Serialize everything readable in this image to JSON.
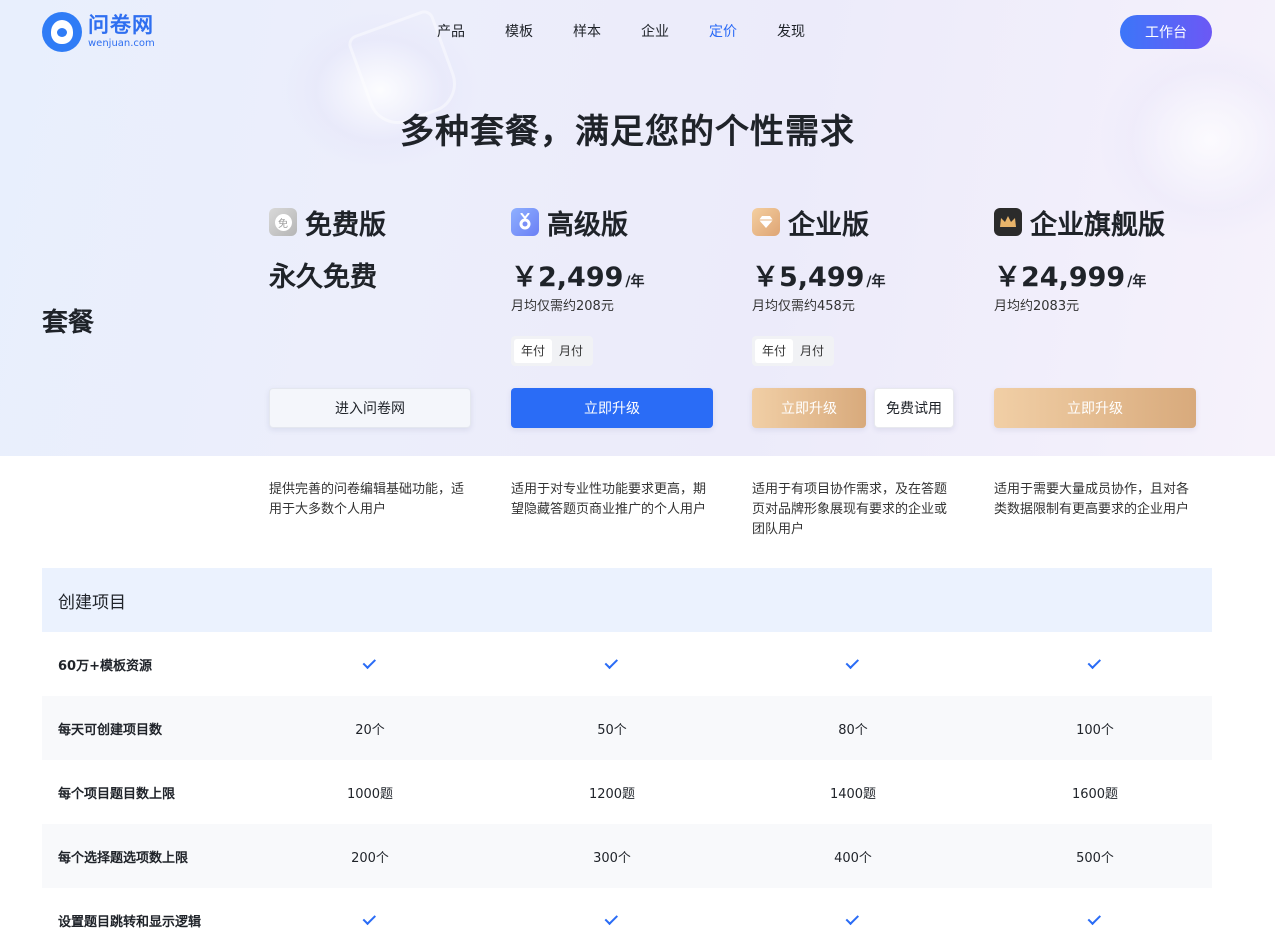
{
  "header": {
    "logo_cn": "问卷网",
    "logo_en": "wenjuan.com",
    "nav": [
      "产品",
      "模板",
      "样本",
      "企业",
      "定价",
      "发现"
    ],
    "nav_active": "定价",
    "workbench_label": "工作台"
  },
  "hero": {
    "title": "多种套餐，满足您的个性需求",
    "package_label": "套餐"
  },
  "plans": [
    {
      "name": "免费版",
      "icon": "free-badge-icon",
      "icon_glyph": "免",
      "price": "永久免费",
      "unit": "",
      "sub": "",
      "toggle": [],
      "buttons": [
        "进入问卷网"
      ],
      "desc": "提供完善的问卷编辑基础功能，适用于大多数个人用户"
    },
    {
      "name": "高级版",
      "icon": "medal-icon",
      "price": "￥2,499",
      "unit": "/年",
      "sub": "月均仅需约208元",
      "toggle": [
        "年付",
        "月付"
      ],
      "buttons": [
        "立即升级"
      ],
      "desc": "适用于对专业性功能要求更高，期望隐藏答题页商业推广的个人用户"
    },
    {
      "name": "企业版",
      "icon": "diamond-icon",
      "price": "￥5,499",
      "unit": "/年",
      "sub": "月均仅需约458元",
      "toggle": [
        "年付",
        "月付"
      ],
      "buttons": [
        "立即升级",
        "免费试用"
      ],
      "desc": "适用于有项目协作需求，及在答题页对品牌形象展现有要求的企业或团队用户"
    },
    {
      "name": "企业旗舰版",
      "icon": "crown-icon",
      "price": "￥24,999",
      "unit": "/年",
      "sub": "月均约2083元",
      "toggle": [],
      "buttons": [
        "立即升级"
      ],
      "desc": "适用于需要大量成员协作，且对各类数据限制有更高要求的企业用户"
    }
  ],
  "section": {
    "title": "创建项目"
  },
  "features": [
    {
      "label": "60万+模板资源",
      "values": [
        "check",
        "check",
        "check",
        "check"
      ]
    },
    {
      "label": "每天可创建项目数",
      "values": [
        "20个",
        "50个",
        "80个",
        "100个"
      ]
    },
    {
      "label": "每个项目题目数上限",
      "values": [
        "1000题",
        "1200题",
        "1400题",
        "1600题"
      ]
    },
    {
      "label": "每个选择题选项数上限",
      "values": [
        "200个",
        "300个",
        "400个",
        "500个"
      ]
    },
    {
      "label": "设置题目跳转和显示逻辑",
      "values": [
        "check",
        "check",
        "check",
        "check"
      ]
    }
  ],
  "colors": {
    "accent": "#2a6cf6",
    "gold": "#d8aa7c",
    "section_bg": "#ebf2fe"
  }
}
